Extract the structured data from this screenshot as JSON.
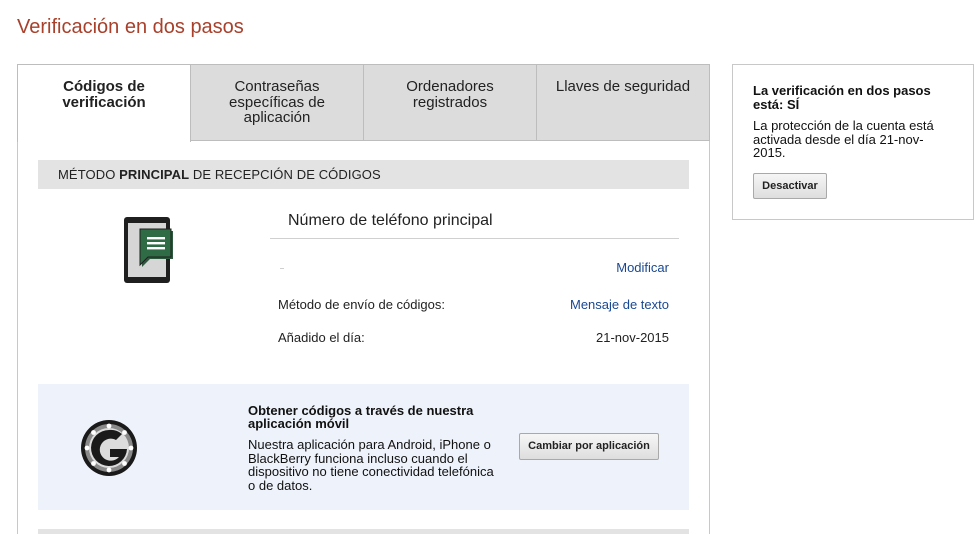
{
  "page": {
    "title": "Verificación en dos pasos"
  },
  "tabs": [
    {
      "label": "Códigos de verificación",
      "active": true
    },
    {
      "label": "Contraseñas específicas de aplicación",
      "active": false
    },
    {
      "label": "Ordenadores registrados",
      "active": false
    },
    {
      "label": "Llaves de seguridad",
      "active": false
    }
  ],
  "primary_method": {
    "header_prefix": "MÉTODO ",
    "header_bold": "PRINCIPAL",
    "header_suffix": " DE RECEPCIÓN DE CÓDIGOS",
    "phone_title": "Número de teléfono principal",
    "modify_label": "Modificar",
    "rows": [
      {
        "label": "Método de envío de códigos:",
        "value": "Mensaje de texto"
      },
      {
        "label": "Añadido el día:",
        "value": "21-nov-2015"
      }
    ]
  },
  "app_promo": {
    "title": "Obtener códigos a través de nuestra aplicación móvil",
    "description": "Nuestra aplicación para Android, iPhone o BlackBerry funciona incluso cuando el dispositivo no tiene conectividad telefónica o de datos.",
    "button_label": "Cambiar por aplicación"
  },
  "status_panel": {
    "title": "La verificación en dos pasos está: SÍ",
    "description": "La protección de la cuenta está activada desde el día 21-nov-2015.",
    "button_label": "Desactivar"
  },
  "colors": {
    "title": "#a8402b",
    "link": "#1a4891",
    "app_box_bg": "#eef3fb",
    "header_bg": "#e3e3e3"
  },
  "icons": [
    "phone-sms-icon",
    "authenticator-g-icon"
  ]
}
